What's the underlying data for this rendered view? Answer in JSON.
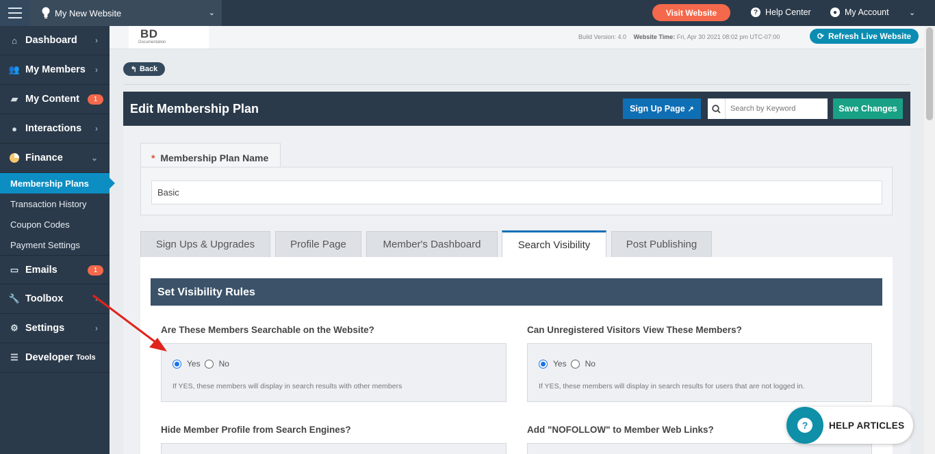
{
  "topbar": {
    "site_name": "My New Website",
    "visit_label": "Visit Website",
    "help_center": "Help Center",
    "my_account": "My Account"
  },
  "sidebar": {
    "items": [
      {
        "label": "Dashboard",
        "icon": "home-icon",
        "arrow": "›"
      },
      {
        "label": "My Members",
        "icon": "users-icon",
        "arrow": "›"
      },
      {
        "label": "My Content",
        "icon": "folder-icon",
        "badge": "1"
      },
      {
        "label": "Interactions",
        "icon": "chat-icon",
        "arrow": "›"
      },
      {
        "label": "Finance",
        "icon": "pie-chart-icon",
        "arrow": "⌄"
      }
    ],
    "finance_sub": [
      "Membership Plans",
      "Transaction History",
      "Coupon Codes",
      "Payment Settings"
    ],
    "items2": [
      {
        "label": "Emails",
        "icon": "inbox-icon",
        "badge": "1"
      },
      {
        "label": "Toolbox",
        "icon": "wrench-icon",
        "arrow": "›"
      },
      {
        "label": "Settings",
        "icon": "gear-icon",
        "arrow": "›"
      },
      {
        "label": "Developer",
        "sub": "Tools",
        "icon": "sliders-icon"
      }
    ]
  },
  "header": {
    "logo_text": "BD",
    "logo_sub": "Documentation",
    "build_version": "Build Version: 4.0",
    "website_time_label": "Website Time:",
    "website_time": "Fri, Apr 30 2021 08:02 pm UTC-07:00",
    "refresh_label": "Refresh Live Website"
  },
  "back_label": "Back",
  "edit": {
    "title": "Edit Membership Plan",
    "signup_label": "Sign Up Page",
    "search_placeholder": "Search by Keyword",
    "save_label": "Save Changes"
  },
  "plan_name": {
    "label": "Membership Plan Name",
    "required": "*",
    "value": "Basic"
  },
  "tabs": [
    "Sign Ups & Upgrades",
    "Profile Page",
    "Member's Dashboard",
    "Search Visibility",
    "Post Publishing"
  ],
  "active_tab": "Search Visibility",
  "visibility": {
    "heading": "Set Visibility Rules",
    "q1": {
      "label": "Are These Members Searchable on the Website?",
      "yes": "Yes",
      "no": "No",
      "selected": "Yes",
      "help": "If YES, these members will display in search results with other members"
    },
    "q2": {
      "label": "Can Unregistered Visitors View These Members?",
      "yes": "Yes",
      "no": "No",
      "selected": "Yes",
      "help": "If YES, these members will display in search results for users that are not logged in."
    },
    "q3": {
      "label": "Hide Member Profile from Search Engines?"
    },
    "q4": {
      "label": "Add \"NOFOLLOW\" to Member Web Links?"
    }
  },
  "help_articles": "HELP ARTICLES",
  "colors": {
    "sidebar_bg": "#2b3a4a",
    "accent_orange": "#f4694b",
    "active_blue": "#0c8ec3",
    "save_green": "#18a185",
    "annotation_arrow": "#e0241b"
  }
}
